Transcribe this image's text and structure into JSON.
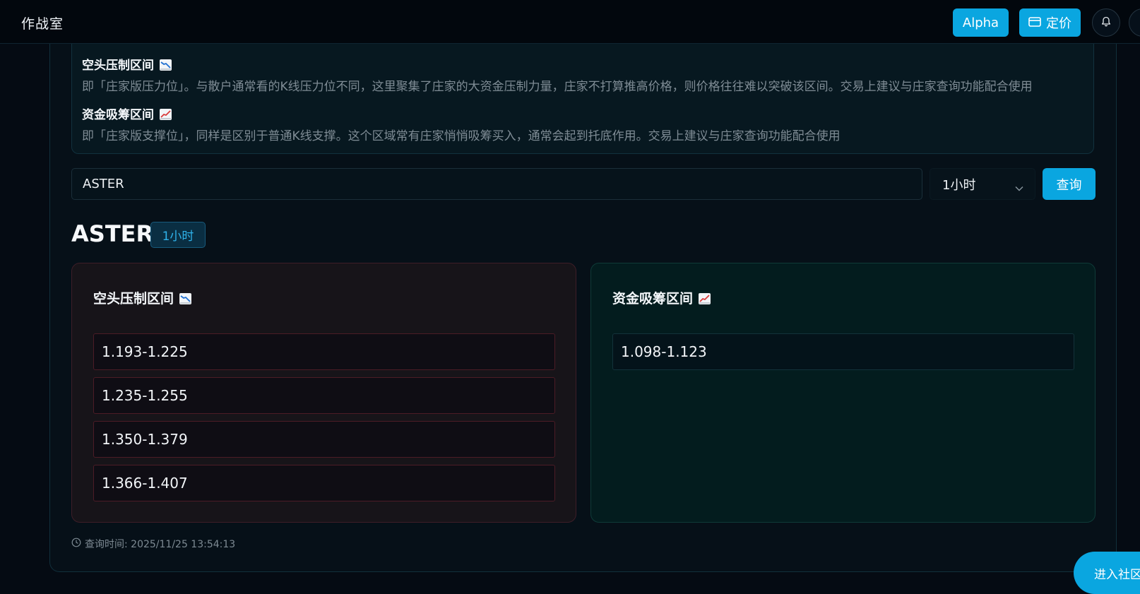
{
  "header": {
    "brand": "作战室",
    "alpha_label": "Alpha",
    "pricing_label": "定价"
  },
  "info": {
    "bear_title": "空头压制区间",
    "bear_desc": "即「庄家版压力位」。与散户通常看的K线压力位不同，这里聚集了庄家的大资金压制力量，庄家不打算推高价格，则价格往往难以突破该区间。交易上建议与庄家查询功能配合使用",
    "bull_title": "资金吸筹区间",
    "bull_desc": "即「庄家版支撑位」，同样是区别于普通K线支撑。这个区域常有庄家悄悄吸筹买入，通常会起到托底作用。交易上建议与庄家查询功能配合使用"
  },
  "search": {
    "value": "ASTER",
    "interval_selected": "1小时",
    "query_label": "查询"
  },
  "result": {
    "symbol": "ASTER",
    "interval_badge": "1小时",
    "bear_card": {
      "title": "空头压制区间",
      "zones": [
        "1.193-1.225",
        "1.235-1.255",
        "1.350-1.379",
        "1.366-1.407"
      ]
    },
    "bull_card": {
      "title": "资金吸筹区间",
      "zones": [
        "1.098-1.123"
      ]
    },
    "query_time": "查询时间: 2025/11/25 13:54:13"
  },
  "floating": {
    "community_label": "进入社区"
  },
  "colors": {
    "accent": "#0aa6e0",
    "bear_border": "#4c1c26",
    "bull_border": "#13323a"
  }
}
